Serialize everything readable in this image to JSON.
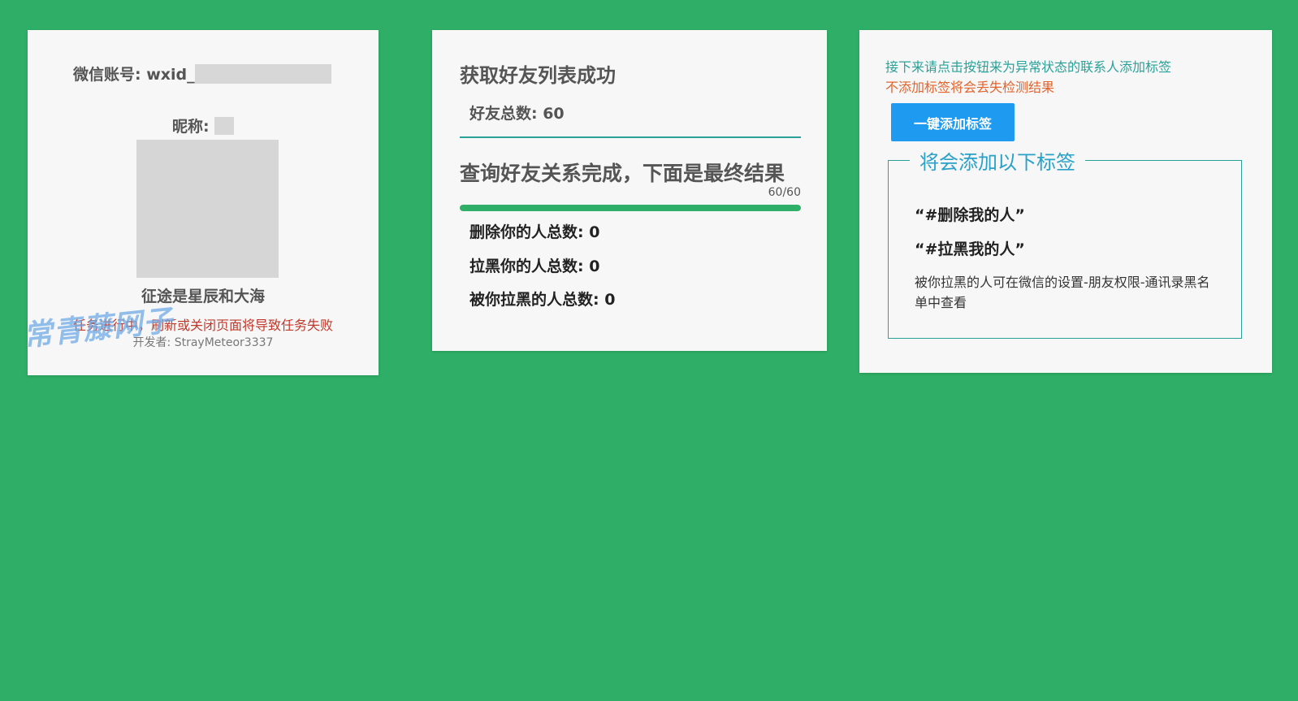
{
  "account": {
    "wechat_id_label": "微信账号: wxid_",
    "nickname_label": "昵称:",
    "motto": "征途是星辰和大海",
    "warning": "任务进行中，刷新或关闭页面将导致任务失败",
    "developer": "开发者: StrayMeteor3337",
    "watermark": "常青藤网子"
  },
  "results": {
    "title": "获取好友列表成功",
    "friend_total": "好友总数: 60",
    "subtitle": "查询好友关系完成，下面是最终结果",
    "progress_text": "60/60",
    "progress_percent": 100,
    "stats": [
      "删除你的人总数: 0",
      "拉黑你的人总数: 0",
      "被你拉黑的人总数: 0"
    ]
  },
  "tags": {
    "hint": "接下来请点击按钮来为异常状态的联系人添加标签",
    "warning": "不添加标签将会丢失检测结果",
    "button_label": "一键添加标签",
    "legend": "将会添加以下标签",
    "items": [
      "“#删除我的人”",
      "“#拉黑我的人”"
    ],
    "note": "被你拉黑的人可在微信的设置-朋友权限-通讯录黑名单中查看"
  },
  "colors": {
    "background": "#2eae66",
    "card": "#f7f7f7",
    "accent_teal": "#2aa198",
    "warning_orange": "#e2632b",
    "warning_red": "#c0392b",
    "button_blue": "#1e9bf0"
  }
}
